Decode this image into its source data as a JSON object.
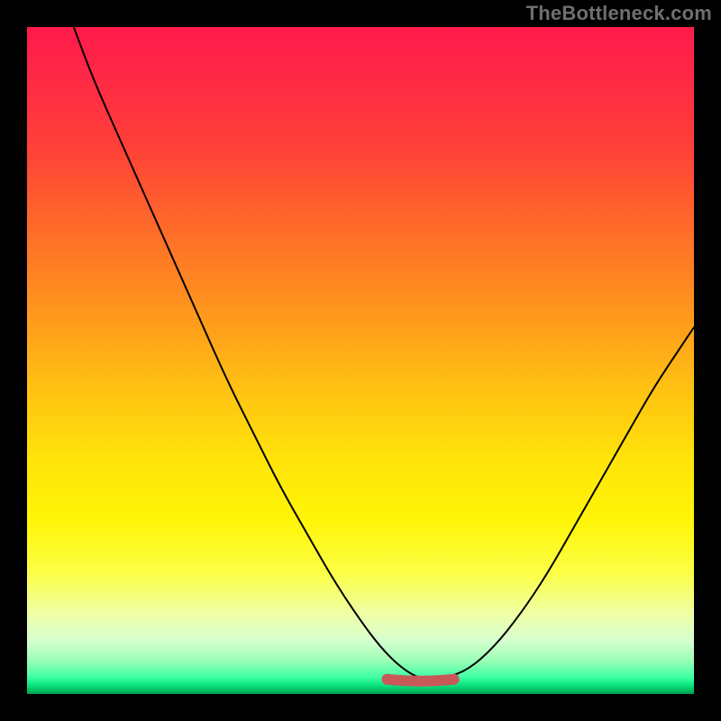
{
  "watermark": "TheBottleneck.com",
  "colors": {
    "frame": "#000000",
    "curve": "#000000",
    "valley": "#c95858",
    "gradient_top": "#ff1a4b",
    "gradient_bottom": "#00a24f"
  },
  "chart_data": {
    "type": "line",
    "title": "",
    "xlabel": "",
    "ylabel": "",
    "xlim": [
      0,
      100
    ],
    "ylim": [
      0,
      100
    ],
    "grid": false,
    "legend": false,
    "annotations": [
      "TheBottleneck.com"
    ],
    "background": {
      "description": "full-area vertical gradient from red (high bottleneck) at y=100 down to green (no bottleneck) at y=0",
      "stops_pct_color": [
        [
          0,
          "#ff1a4b"
        ],
        [
          8,
          "#ff2a45"
        ],
        [
          18,
          "#ff4038"
        ],
        [
          30,
          "#ff6a2a"
        ],
        [
          42,
          "#ff941e"
        ],
        [
          55,
          "#ffc412"
        ],
        [
          65,
          "#ffe40a"
        ],
        [
          74,
          "#fff507"
        ],
        [
          82,
          "#fbff48"
        ],
        [
          88,
          "#efffa6"
        ],
        [
          92,
          "#d6ffcf"
        ],
        [
          95,
          "#9bffb7"
        ],
        [
          97.5,
          "#3effa4"
        ],
        [
          98.5,
          "#13e987"
        ],
        [
          99.3,
          "#00c66a"
        ],
        [
          100,
          "#00a24f"
        ]
      ]
    },
    "series": [
      {
        "name": "bottleneck-curve",
        "x": [
          7,
          10,
          14,
          18,
          22,
          26,
          30,
          34,
          38,
          42,
          46,
          50,
          53,
          56,
          59,
          62,
          66,
          70,
          74,
          78,
          82,
          86,
          90,
          94,
          98,
          100
        ],
        "y": [
          100,
          92,
          83,
          74,
          65,
          56,
          47,
          39,
          31,
          24,
          17,
          11,
          7,
          4,
          2.2,
          2.2,
          3.5,
          7,
          12,
          18,
          25,
          32,
          39,
          46,
          52,
          55
        ]
      }
    ],
    "highlight": {
      "name": "valley-optimal-range",
      "x_start": 54,
      "x_end": 64,
      "y_approx": 2.2,
      "style": "thick-rounded",
      "color": "#c95858"
    }
  }
}
